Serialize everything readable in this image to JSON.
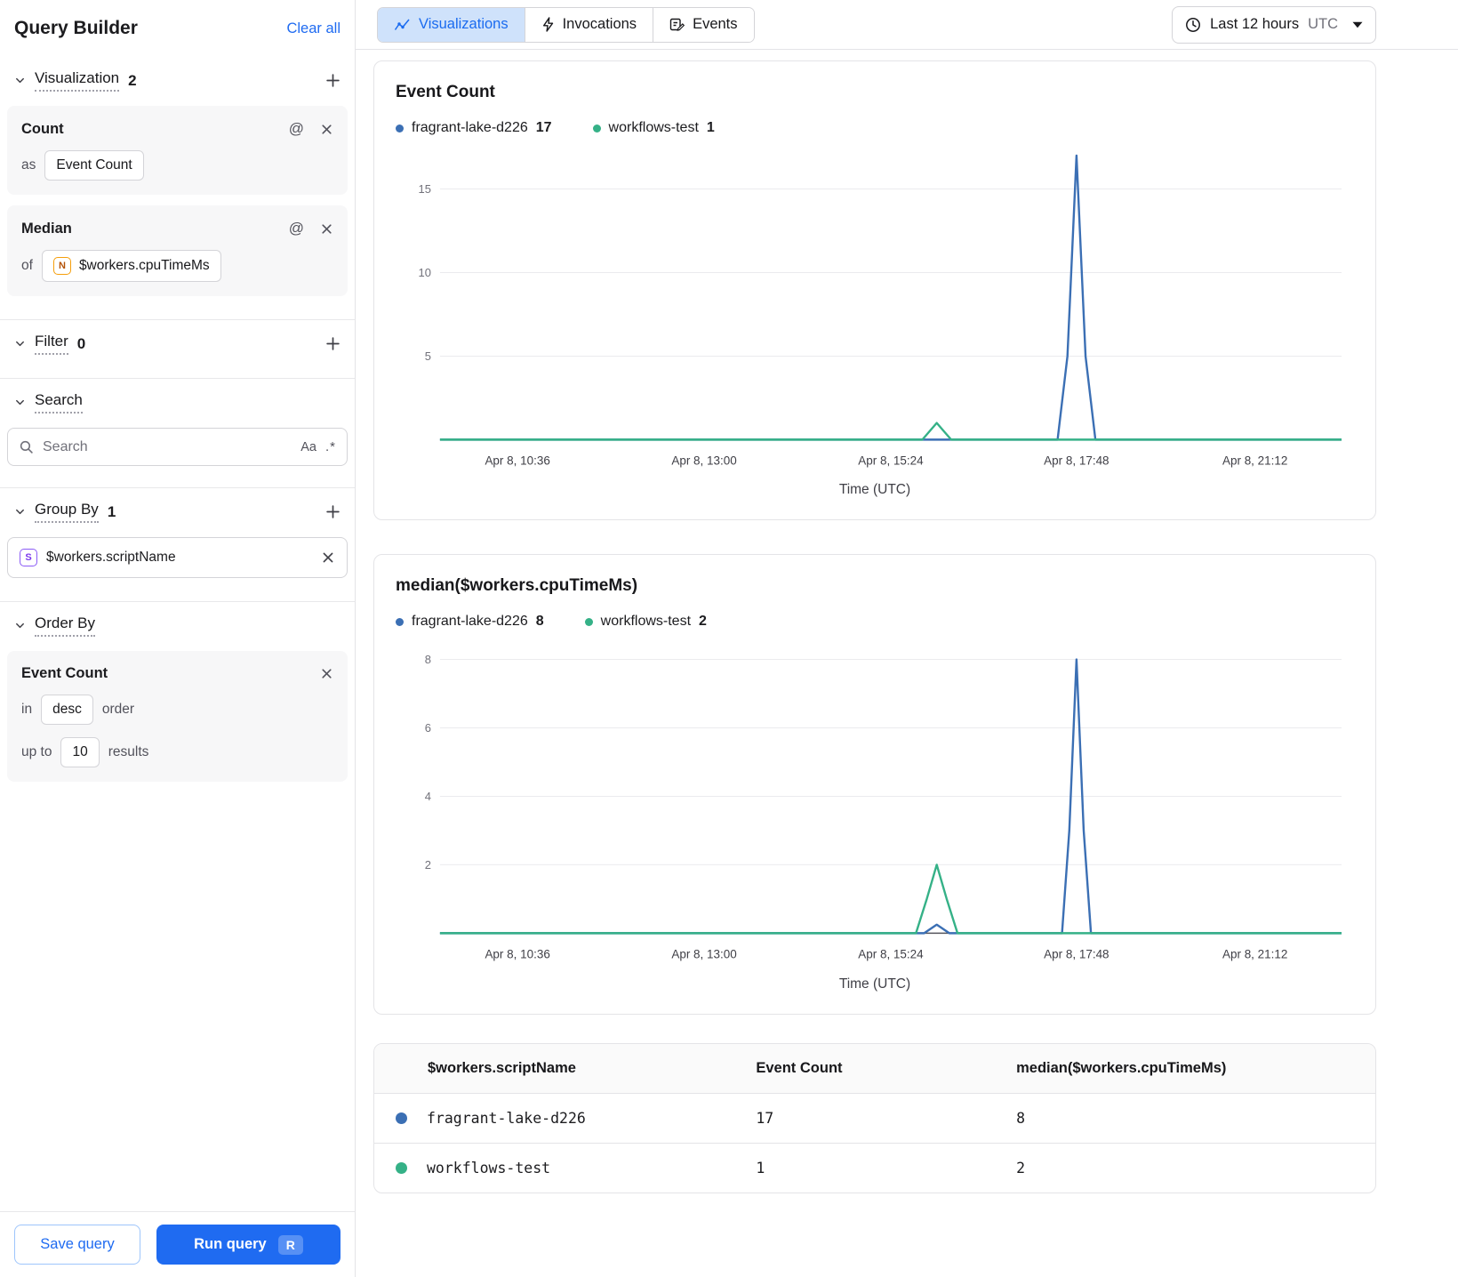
{
  "colors": {
    "accent": "#1f6bf1",
    "active_tab_bg": "#cfe2fb",
    "series_blue": "#3b6fb4",
    "series_green": "#35b187"
  },
  "sidebar": {
    "title": "Query Builder",
    "clear_all": "Clear all",
    "visualization": {
      "label": "Visualization",
      "count": "2",
      "count_card": {
        "title": "Count",
        "prefix": "as",
        "value": "Event Count"
      },
      "median_card": {
        "title": "Median",
        "prefix": "of",
        "type_letter": "N",
        "value": "$workers.cpuTimeMs"
      },
      "at_glyph": "@"
    },
    "filter": {
      "label": "Filter",
      "count": "0"
    },
    "search": {
      "label": "Search",
      "placeholder": "Search",
      "match_case_glyph": "Aa",
      "regex_glyph": ".*"
    },
    "group_by": {
      "label": "Group By",
      "count": "1",
      "type_letter": "S",
      "field": "$workers.scriptName"
    },
    "order_by": {
      "label": "Order By",
      "card": {
        "title": "Event Count",
        "in_label": "in",
        "direction": "desc",
        "order_label": "order",
        "upto_label": "up to",
        "limit": "10",
        "results_label": "results"
      }
    },
    "save_button": "Save query",
    "run_button": "Run query",
    "run_kbd": "R"
  },
  "topbar": {
    "tabs": [
      {
        "label": "Visualizations",
        "active": true
      },
      {
        "label": "Invocations",
        "active": false
      },
      {
        "label": "Events",
        "active": false
      }
    ],
    "time_range": {
      "label": "Last 12 hours",
      "timezone": "UTC"
    }
  },
  "chart_data": [
    {
      "type": "line",
      "title": "Event Count",
      "xlabel": "Time (UTC)",
      "ylim": [
        0,
        17
      ],
      "y_ticks": [
        5,
        10,
        15
      ],
      "x_ticks": [
        {
          "label": "Apr 8, 10:36",
          "pos": 0.086
        },
        {
          "label": "Apr 8, 13:00",
          "pos": 0.293
        },
        {
          "label": "Apr 8, 15:24",
          "pos": 0.5
        },
        {
          "label": "Apr 8, 17:48",
          "pos": 0.706
        },
        {
          "label": "Apr 8, 21:12",
          "pos": 0.904
        }
      ],
      "legend": [
        {
          "name": "fragrant-lake-d226",
          "value": 17,
          "color": "#3b6fb4"
        },
        {
          "name": "workflows-test",
          "value": 1,
          "color": "#35b187"
        }
      ],
      "series": [
        {
          "name": "fragrant-lake-d226",
          "color": "#3b6fb4",
          "points": [
            [
              0,
              0
            ],
            [
              0.685,
              0
            ],
            [
              0.696,
              5
            ],
            [
              0.706,
              17
            ],
            [
              0.716,
              5
            ],
            [
              0.727,
              0
            ],
            [
              1,
              0
            ]
          ]
        },
        {
          "name": "workflows-test",
          "color": "#35b187",
          "points": [
            [
              0,
              0
            ],
            [
              0.535,
              0
            ],
            [
              0.543,
              0.5
            ],
            [
              0.551,
              1
            ],
            [
              0.559,
              0.5
            ],
            [
              0.567,
              0
            ],
            [
              1,
              0
            ]
          ]
        }
      ]
    },
    {
      "type": "line",
      "title": "median($workers.cpuTimeMs)",
      "xlabel": "Time (UTC)",
      "ylim": [
        0,
        8.3
      ],
      "y_ticks": [
        2,
        4,
        6,
        8
      ],
      "x_ticks": [
        {
          "label": "Apr 8, 10:36",
          "pos": 0.086
        },
        {
          "label": "Apr 8, 13:00",
          "pos": 0.293
        },
        {
          "label": "Apr 8, 15:24",
          "pos": 0.5
        },
        {
          "label": "Apr 8, 17:48",
          "pos": 0.706
        },
        {
          "label": "Apr 8, 21:12",
          "pos": 0.904
        }
      ],
      "legend": [
        {
          "name": "fragrant-lake-d226",
          "value": 8,
          "color": "#3b6fb4"
        },
        {
          "name": "workflows-test",
          "value": 2,
          "color": "#35b187"
        }
      ],
      "series": [
        {
          "name": "fragrant-lake-d226",
          "color": "#3b6fb4",
          "points": [
            [
              0,
              0
            ],
            [
              0.537,
              0
            ],
            [
              0.551,
              0.25
            ],
            [
              0.565,
              0
            ],
            [
              0.69,
              0
            ],
            [
              0.698,
              3
            ],
            [
              0.706,
              8
            ],
            [
              0.714,
              3
            ],
            [
              0.722,
              0
            ],
            [
              1,
              0
            ]
          ]
        },
        {
          "name": "workflows-test",
          "color": "#35b187",
          "points": [
            [
              0,
              0
            ],
            [
              0.528,
              0
            ],
            [
              0.54,
              1
            ],
            [
              0.551,
              2
            ],
            [
              0.562,
              1
            ],
            [
              0.574,
              0
            ],
            [
              1,
              0
            ]
          ]
        }
      ]
    }
  ],
  "results_table": {
    "headers": [
      "$workers.scriptName",
      "Event Count",
      "median($workers.cpuTimeMs)"
    ],
    "rows": [
      {
        "color": "#3b6fb4",
        "name": "fragrant-lake-d226",
        "event_count": "17",
        "median": "8"
      },
      {
        "color": "#35b187",
        "name": "workflows-test",
        "event_count": "1",
        "median": "2"
      }
    ]
  }
}
